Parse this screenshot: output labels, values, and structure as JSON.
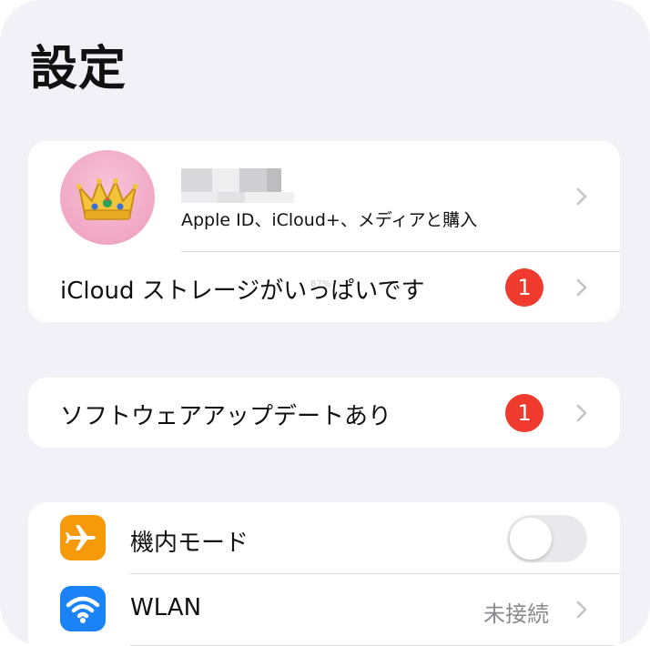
{
  "page": {
    "title": "設定"
  },
  "account": {
    "subtitle": "Apple ID、iCloud+、メディアと購入",
    "avatar_icon": "crown-icon"
  },
  "storage": {
    "label": "iCloud ストレージがいっぱいです",
    "badge_count": "1"
  },
  "software_update": {
    "label": "ソフトウェアアップデートあり",
    "badge_count": "1"
  },
  "network": {
    "airplane": {
      "label": "機内モード",
      "icon": "airplane-icon",
      "icon_color": "#f79a0a",
      "toggle_on": false
    },
    "wlan": {
      "label": "WLAN",
      "value": "未接続",
      "icon": "wifi-icon",
      "icon_color": "#1b82f7"
    }
  },
  "colors": {
    "background": "#f2f1f7",
    "badge": "#f03a2e",
    "chevron": "#c4c4c7"
  }
}
